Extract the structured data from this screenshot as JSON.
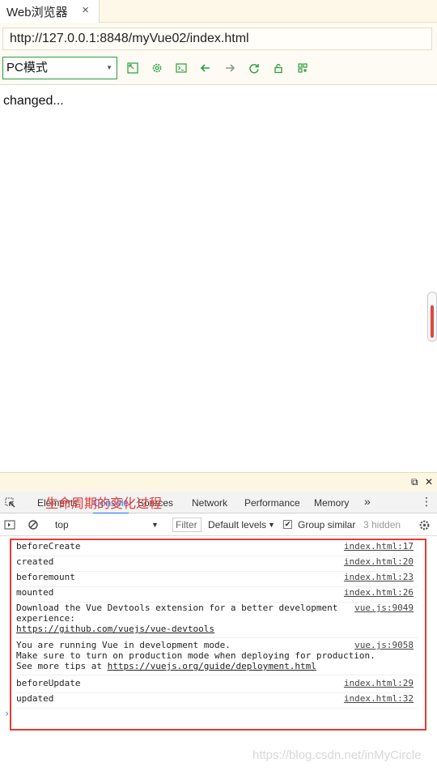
{
  "tab": {
    "title": "Web浏览器",
    "close": "×"
  },
  "address_bar": {
    "url": "http://127.0.0.1:8848/myVue02/index.html"
  },
  "toolbar": {
    "mode_select": "PC模式",
    "icons": [
      "screenshot-icon",
      "settings-icon",
      "terminal-icon",
      "back-icon",
      "forward-icon",
      "refresh-icon",
      "lock-icon",
      "qrcode-icon"
    ],
    "accent": "#2c9c3c"
  },
  "page": {
    "text": "changed..."
  },
  "devtools": {
    "window_buttons": [
      "undock-icon",
      "close-icon"
    ],
    "tabs": [
      "Elements",
      "Console",
      "Sources",
      "Network",
      "Performance",
      "Memory"
    ],
    "more": "»",
    "active_tab": "Console",
    "annotation": "生命周期的变化过程",
    "filter": {
      "context": "top",
      "filter_placeholder": "Filter",
      "levels": "Default levels",
      "group_similar": "Group similar",
      "hidden": "3 hidden"
    },
    "console": [
      {
        "text": "beforeCreate",
        "src": "index.html:17"
      },
      {
        "text": "created",
        "src": "index.html:20"
      },
      {
        "text": "beforemount",
        "src": "index.html:23"
      },
      {
        "text": "mounted",
        "src": "index.html:26"
      },
      {
        "text": "Download the Vue Devtools extension for a better development\nexperience:",
        "link": "https://github.com/vuejs/vue-devtools",
        "src": "vue.js:9049"
      },
      {
        "text": "You are running Vue in development mode.\nMake sure to turn on production mode when deploying for production.\nSee more tips at ",
        "link": "https://vuejs.org/guide/deployment.html",
        "src": "vue.js:9058"
      },
      {
        "text": "beforeUpdate",
        "src": "index.html:29"
      },
      {
        "text": "updated",
        "src": "index.html:32"
      }
    ],
    "prompt": "›",
    "highlight_color": "#e53935"
  },
  "watermark": "https://blog.csdn.net/inMyCircle"
}
